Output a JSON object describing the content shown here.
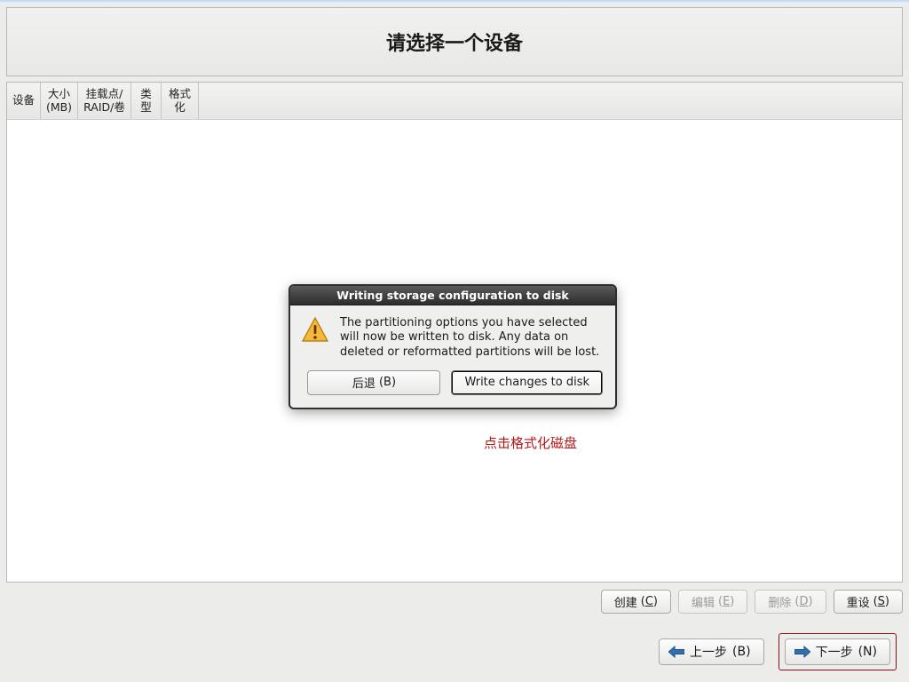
{
  "page": {
    "title": "请选择一个设备"
  },
  "columns": {
    "device": "设备",
    "size_l1": "大小",
    "size_l2": "(MB)",
    "mount_l1": "挂载点/",
    "mount_l2": "RAID/卷",
    "type": "类型",
    "format": "格式化"
  },
  "toolbar": {
    "create": "创建",
    "create_key": "C",
    "edit": "编辑",
    "edit_key": "E",
    "delete": "删除",
    "delete_key": "D",
    "reset": "重设",
    "reset_key": "S"
  },
  "nav": {
    "back": "上一步",
    "back_key": "B",
    "next": "下一步",
    "next_key": "N"
  },
  "dialog": {
    "title": "Writing storage configuration to disk",
    "message": "The partitioning options you have selected will now be written to disk.  Any data on deleted or reformatted partitions will be lost.",
    "back": "后退",
    "back_key": "B",
    "write_pre": "W",
    "write_rest": "rite changes to disk"
  },
  "annot": {
    "click": "点击格式化磁盘"
  }
}
